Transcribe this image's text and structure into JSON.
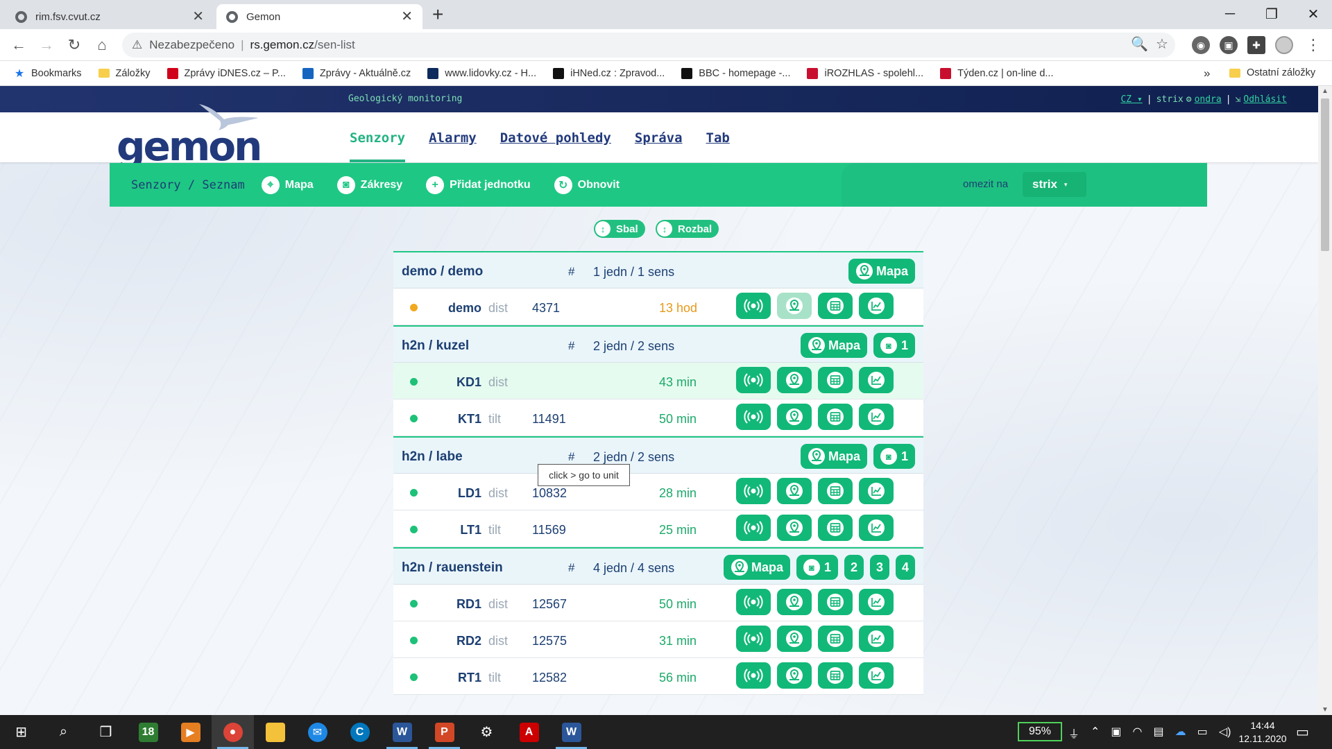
{
  "browser": {
    "tabs": [
      {
        "title": "rim.fsv.cvut.cz",
        "active": false
      },
      {
        "title": "Gemon",
        "active": true
      }
    ],
    "security_label": "Nezabezpečeno",
    "url_host": "rs.gemon.cz",
    "url_path": "/sen-list",
    "bookmarks": [
      {
        "label": "Bookmarks",
        "icon": "star-icon",
        "color": "#1a73e8"
      },
      {
        "label": "Záložky",
        "icon": "folder-icon",
        "color": "#f7cf4c"
      },
      {
        "label": "Zprávy iDNES.cz – P...",
        "icon": "idnes-icon",
        "color": "#d0021b"
      },
      {
        "label": "Zprávy - Aktuálně.cz",
        "icon": "aktualne-icon",
        "color": "#1565c0"
      },
      {
        "label": "www.lidovky.cz - H...",
        "icon": "lidovky-icon",
        "color": "#0d2a5c"
      },
      {
        "label": "iHNed.cz : Zpravod...",
        "icon": "hn-icon",
        "color": "#111111"
      },
      {
        "label": "BBC - homepage -...",
        "icon": "bbc-icon",
        "color": "#111111"
      },
      {
        "label": "iROZHLAS - spolehl...",
        "icon": "irozhlas-icon",
        "color": "#c8102e"
      },
      {
        "label": "Týden.cz | on-line d...",
        "icon": "tyden-icon",
        "color": "#c8102e"
      }
    ],
    "bookmarks_more": "»",
    "other_bookmarks": "Ostatní záložky"
  },
  "site": {
    "subtitle": "Geologický monitoring",
    "logo": "gemon",
    "lang": "CZ",
    "lang_caret": "▾",
    "account": "strix",
    "user": "ondra",
    "logout": "Odhlásit",
    "nav": [
      {
        "label": "Senzory",
        "active": true
      },
      {
        "label": "Alarmy",
        "active": false
      },
      {
        "label": "Datové pohledy",
        "active": false
      },
      {
        "label": "Správa",
        "active": false
      },
      {
        "label": "Tab",
        "active": false
      }
    ],
    "colors": {
      "accent": "#1fc784",
      "navy": "#1c3f72",
      "warning": "#f2a81d"
    }
  },
  "toolbar": {
    "breadcrumb": "Senzory / Seznam",
    "map": "Mapa",
    "drawings": "Zákresy",
    "add_unit": "Přidat jednotku",
    "refresh": "Obnovit",
    "limit_label": "omezit na",
    "limit_value": "strix",
    "limit_caret": "▾"
  },
  "list_controls": {
    "collapse": "Sbal",
    "expand": "Rozbal"
  },
  "groups": [
    {
      "name": "demo / demo",
      "hash": "#",
      "summary": "1 jedn / 1 sens",
      "map": "Mapa",
      "drawings": [],
      "rows": [
        {
          "name": "demo",
          "type": "dist",
          "id": "4371",
          "age": "13 hod",
          "status": "warning",
          "map_disabled": true
        }
      ]
    },
    {
      "name": "h2n / kuzel",
      "hash": "#",
      "summary": "2 jedn / 2 sens",
      "map": "Mapa",
      "drawings": [
        "1"
      ],
      "rows": [
        {
          "name": "KD1",
          "type": "dist",
          "id": "",
          "age": "43 min",
          "status": "ok",
          "highlight": true
        },
        {
          "name": "KT1",
          "type": "tilt",
          "id": "11491",
          "age": "50 min",
          "status": "ok"
        }
      ]
    },
    {
      "name": "h2n / labe",
      "hash": "#",
      "summary": "2 jedn / 2 sens",
      "map": "Mapa",
      "drawings": [
        "1"
      ],
      "rows": [
        {
          "name": "LD1",
          "type": "dist",
          "id": "10832",
          "age": "28 min",
          "status": "ok"
        },
        {
          "name": "LT1",
          "type": "tilt",
          "id": "11569",
          "age": "25 min",
          "status": "ok"
        }
      ]
    },
    {
      "name": "h2n / rauenstein",
      "hash": "#",
      "summary": "4 jedn / 4 sens",
      "map": "Mapa",
      "drawings": [
        "1",
        "2",
        "3",
        "4"
      ],
      "rows": [
        {
          "name": "RD1",
          "type": "dist",
          "id": "12567",
          "age": "50 min",
          "status": "ok"
        },
        {
          "name": "RD2",
          "type": "dist",
          "id": "12575",
          "age": "31 min",
          "status": "ok"
        },
        {
          "name": "RT1",
          "type": "tilt",
          "id": "12582",
          "age": "56 min",
          "status": "ok"
        }
      ]
    }
  ],
  "tooltip": "click > go to unit",
  "taskbar": {
    "battery": "95%",
    "time": "14:44",
    "date": "12.11.2020"
  }
}
